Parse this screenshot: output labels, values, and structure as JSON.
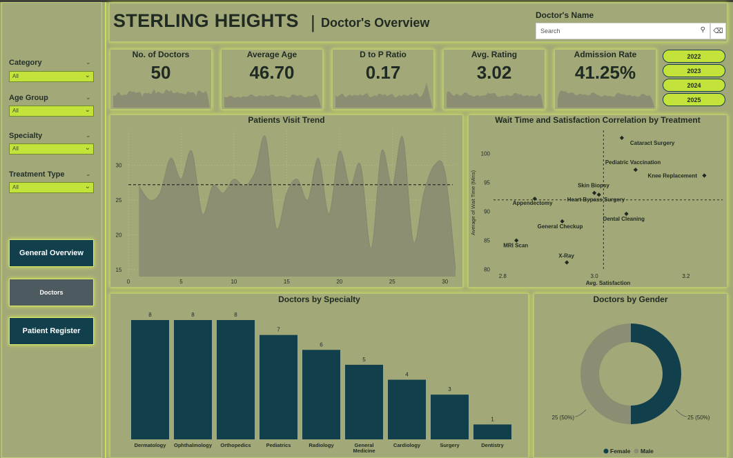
{
  "header": {
    "brand": "STERLING HEIGHTS",
    "separator": "|",
    "subtitle": "Doctor's Overview",
    "doctor_name_label": "Doctor's Name",
    "search_placeholder": "Search"
  },
  "filters": [
    {
      "label": "Category",
      "value": "All"
    },
    {
      "label": "Age Group",
      "value": "All"
    },
    {
      "label": "Specialty",
      "value": "All"
    },
    {
      "label": "Treatment Type",
      "value": "All"
    }
  ],
  "nav": {
    "general": "General Overview",
    "doctors": "Doctors",
    "patient": "Patient Register"
  },
  "colors": {
    "accent": "#c3e33a",
    "teal": "#123f4c",
    "active_nav": "#4d5a5f",
    "grey_area": "#8c8d73",
    "background": "#a3a878"
  },
  "kpis": [
    {
      "title": "No. of Doctors",
      "value": "50"
    },
    {
      "title": "Average Age",
      "value": "46.70"
    },
    {
      "title": "D to P Ratio",
      "value": "0.17"
    },
    {
      "title": "Avg. Rating",
      "value": "3.02"
    },
    {
      "title": "Admission Rate",
      "value": "41.25%"
    }
  ],
  "years": [
    "2022",
    "2023",
    "2024",
    "2025"
  ],
  "chart_data": [
    {
      "type": "area",
      "title": "Patients Visit Trend",
      "xlabel": "",
      "ylabel": "",
      "x_ticks": [
        0,
        5,
        10,
        15,
        20,
        25,
        30
      ],
      "y_ticks": [
        15,
        20,
        25,
        30
      ],
      "xlim": [
        0,
        31
      ],
      "ylim": [
        14,
        35
      ],
      "x": [
        1,
        2,
        3,
        4,
        5,
        6,
        7,
        8,
        9,
        10,
        11,
        12,
        13,
        14,
        15,
        16,
        17,
        18,
        19,
        20,
        21,
        22,
        23,
        24,
        25,
        26,
        27,
        28,
        29,
        30,
        31
      ],
      "values": [
        27,
        25,
        26,
        31,
        28,
        32,
        23,
        27,
        26,
        28,
        27,
        29,
        34,
        21,
        26,
        28,
        25,
        31,
        23,
        32,
        27,
        30,
        18,
        32,
        27,
        34,
        19,
        26,
        30,
        29,
        15
      ],
      "average": 27.2
    },
    {
      "type": "scatter",
      "title": "Wait Time and Satisfaction Correlation by Treatment",
      "xlabel": "Avg. Satisfaction",
      "ylabel": "Average of Wait Time (Mins)",
      "x_ticks": [
        2.8,
        3.0,
        3.2
      ],
      "y_ticks": [
        80,
        85,
        90,
        95,
        100
      ],
      "xlim": [
        2.78,
        3.28
      ],
      "ylim": [
        79,
        104
      ],
      "points": [
        {
          "label": "Cataract Surgery",
          "x": 3.06,
          "y": 102.7
        },
        {
          "label": "Pediatric Vaccination",
          "x": 3.09,
          "y": 97.2
        },
        {
          "label": "Knee Replacement",
          "x": 3.24,
          "y": 96.2
        },
        {
          "label": "Skin Biopsy",
          "x": 3.0,
          "y": 93.2
        },
        {
          "label": "Heart Bypass Surgery",
          "x": 3.01,
          "y": 92.9
        },
        {
          "label": "Appendectomy",
          "x": 2.87,
          "y": 92.2
        },
        {
          "label": "Dental Cleaning",
          "x": 3.07,
          "y": 89.6
        },
        {
          "label": "General Checkup",
          "x": 2.93,
          "y": 88.3
        },
        {
          "label": "MRI Scan",
          "x": 2.83,
          "y": 85.0
        },
        {
          "label": "X-Ray",
          "x": 2.94,
          "y": 81.2
        }
      ],
      "avg_x": 3.02,
      "avg_y": 92.0
    },
    {
      "type": "bar",
      "title": "Doctors by Specialty",
      "categories": [
        "Dermatology",
        "Ophthalmology",
        "Orthopedics",
        "Pediatrics",
        "Radiology",
        "General Medicine",
        "Cardiology",
        "Surgery",
        "Dentistry"
      ],
      "category_lines": [
        [
          "Dermatology"
        ],
        [
          "Ophthalmology"
        ],
        [
          "Orthopedics"
        ],
        [
          "Pediatrics"
        ],
        [
          "Radiology"
        ],
        [
          "General",
          "Medicine"
        ],
        [
          "Cardiology"
        ],
        [
          "Surgery"
        ],
        [
          "Dentistry"
        ]
      ],
      "values": [
        8,
        8,
        8,
        7,
        6,
        5,
        4,
        3,
        1
      ],
      "ylim": [
        0,
        8
      ]
    },
    {
      "type": "pie",
      "title": "Doctors by Gender",
      "slices": [
        {
          "name": "Female",
          "value": 25,
          "label": "25 (50%)",
          "color": "#123f4c"
        },
        {
          "name": "Male",
          "value": 25,
          "label": "25 (50%)",
          "color": "#8c8d73"
        }
      ]
    }
  ]
}
